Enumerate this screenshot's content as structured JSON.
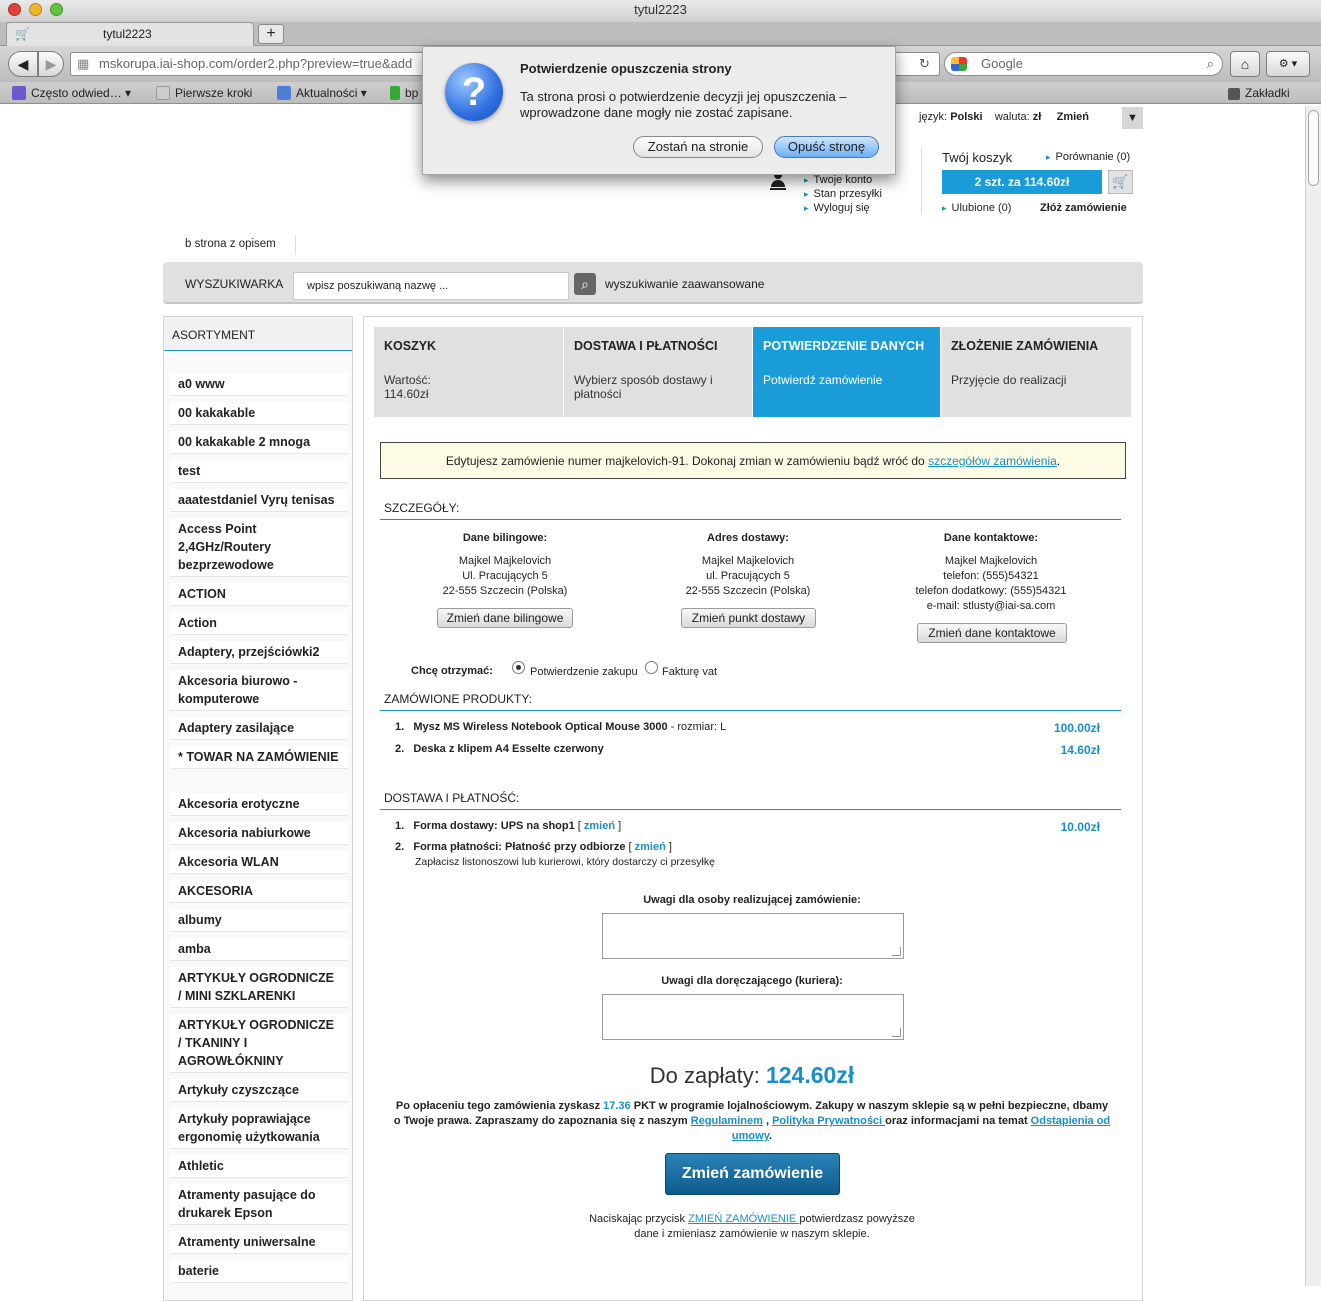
{
  "window": {
    "title": "tytul2223"
  },
  "tab": {
    "label": "tytul2223",
    "new_tab_label": "+"
  },
  "nav": {
    "url": "mskorupa.iai-shop.com/order2.php?preview=true&add",
    "search_placeholder": "Google"
  },
  "bookmarks": {
    "most_visited": "Często odwied…",
    "first_steps": "Pierwsze kroki",
    "news": "Aktualności",
    "bp": "bp",
    "bookmarks_menu": "Zakładki"
  },
  "dialog": {
    "title": "Potwierdzenie opuszczenia strony",
    "message": "Ta strona prosi o potwierdzenie decyzji jej opuszczenia – wprowadzone dane mogły nie zostać zapisane.",
    "stay_label": "Zostań na stronie",
    "leave_label": "Opuść stronę"
  },
  "header": {
    "lang_label": "język:",
    "lang_value": "Polski",
    "currency_label": "waluta:",
    "currency_value": "zł",
    "change_label": "Zmień",
    "account_links": [
      "Twoje konto",
      "Stan przesyłki",
      "Wyloguj się"
    ],
    "cart_title": "Twój koszyk",
    "cart_button": "2 szt. za 114.60zł",
    "compare": "Porównanie (0)",
    "favorites": "Ulubione (0)",
    "place_order": "Złóż zamówienie",
    "page_link": "b strona z opisem"
  },
  "search": {
    "label": "WYSZUKIWARKA",
    "placeholder": "wpisz poszukiwaną nazwę ...",
    "advanced": "wyszukiwanie zaawansowane"
  },
  "sidebar": {
    "title": "ASORTYMENT",
    "items": [
      "a0 www",
      "00 kakakable",
      "00 kakakable 2 mnoga",
      "test",
      "aaatestdaniel Vyrų tenisas",
      "Access Point 2,4GHz/Routery bezprzewodowe",
      "ACTION",
      "Action",
      "Adaptery, przejściówki2",
      "Akcesoria biurowo - komputerowe",
      "Adaptery zasilające",
      "* TOWAR NA ZAMÓWIENIE",
      "Akcesoria erotyczne",
      "Akcesoria nabiurkowe",
      "Akcesoria WLAN",
      "AKCESORIA",
      "albumy",
      "amba",
      "ARTYKUŁY OGRODNICZE / MINI SZKLARENKI",
      "ARTYKUŁY OGRODNICZE / TKANINY I AGROWŁÓKNINY",
      "Artykuły czyszczące",
      "Artykuły poprawiające ergonomię użytkowania",
      "Athletic",
      "Atramenty pasujące do drukarek Epson",
      "Atramenty uniwersalne",
      "baterie"
    ]
  },
  "steps": [
    {
      "title": "KOSZYK",
      "desc": "Wartość:\n114.60zł"
    },
    {
      "title": "DOSTAWA I PŁATNOŚCI",
      "desc": "Wybierz sposób dostawy i płatności"
    },
    {
      "title": "POTWIERDZENIE DANYCH",
      "desc": "Potwierdź zamówienie"
    },
    {
      "title": "ZŁOŻENIE ZAMÓWIENIA",
      "desc": "Przyjęcie do realizacji"
    }
  ],
  "notice": {
    "text": "Edytujesz zamówienie numer majkelovich-91. Dokonaj zmian w zamówieniu bądź wróć do ",
    "link": "szczegółów zamówienia",
    "end": "."
  },
  "details": {
    "title": "SZCZEGÓŁY:",
    "billing": {
      "title": "Dane bilingowe:",
      "line1": "Majkel Majkelovich",
      "line2": "Ul. Pracujących 5",
      "line3": "22-555 Szczecin (Polska)",
      "button": "Zmień dane bilingowe"
    },
    "shipping": {
      "title": "Adres dostawy:",
      "line1": "Majkel Majkelovich",
      "line2": "ul. Pracujących 5",
      "line3": "22-555 Szczecin (Polska)",
      "button": "Zmień punkt dostawy"
    },
    "contact": {
      "title": "Dane kontaktowe:",
      "line1": "Majkel Majkelovich",
      "line2": "telefon: (555)54321",
      "line3": "telefon dodatkowy: (555)54321",
      "line4": "e-mail: stlusty@iai-sa.com",
      "button": "Zmień dane kontaktowe"
    }
  },
  "receive": {
    "label": "Chcę otrzymać:",
    "opt1": "Potwierdzenie zakupu",
    "opt2": "Fakturę vat"
  },
  "products": {
    "title": "ZAMÓWIONE PRODUKTY:",
    "items": [
      {
        "num": "1.",
        "name": "Mysz MS Wireless Notebook Optical Mouse 3000",
        "extra": " - rozmiar: L",
        "price": "100.00zł"
      },
      {
        "num": "2.",
        "name": "Deska z klipem A4 Esselte czerwony",
        "extra": "",
        "price": "14.60zł"
      }
    ]
  },
  "delivery": {
    "title": "DOSTAWA I PŁATNOŚĆ:",
    "shipping_num": "1.",
    "shipping_label": "Forma dostawy: UPS na shop1",
    "shipping_change": "zmień",
    "shipping_price": "10.00zł",
    "payment_num": "2.",
    "payment_label": "Forma płatności: Płatność przy odbiorze",
    "payment_change": "zmień",
    "payment_note": "Zapłacisz listonoszowi lub kurierowi, który dostarczy ci przesyłkę"
  },
  "notes": {
    "label1": "Uwagi dla osoby realizującej zamówienie:",
    "label2": "Uwagi dla doręczającego (kuriera):"
  },
  "total": {
    "label": "Do zapłaty:",
    "value": "124.60zł"
  },
  "loyalty": {
    "p1": "Po opłaceniu tego zamówienia zyskasz ",
    "points": "17.36",
    "p2": " PKT w programie lojalnościowym. Zakupy w naszym sklepie są w pełni bezpieczne, dbamy o Twoje prawa. Zapraszamy do zapoznania się z naszym ",
    "regulamin": "Regulaminem",
    "sep": " , ",
    "privacy": "Polityka Prywatności ",
    "p3": "oraz informacjami na temat ",
    "withdraw": "Odstąpienia od umowy",
    "p4": "."
  },
  "submit": {
    "label": "Zmień zamówienie"
  },
  "footer_note": {
    "p1": "Naciskając przycisk ",
    "link": "ZMIEŃ ZAMÓWIENIE ",
    "p2": "potwierdzasz powyższe",
    "p3": "dane i zmieniasz zamówienie w naszym sklepie."
  },
  "colors": {
    "accent": "#1a8ec9",
    "active_step": "#1a9cd8",
    "notice_bg": "#fefbe4"
  }
}
